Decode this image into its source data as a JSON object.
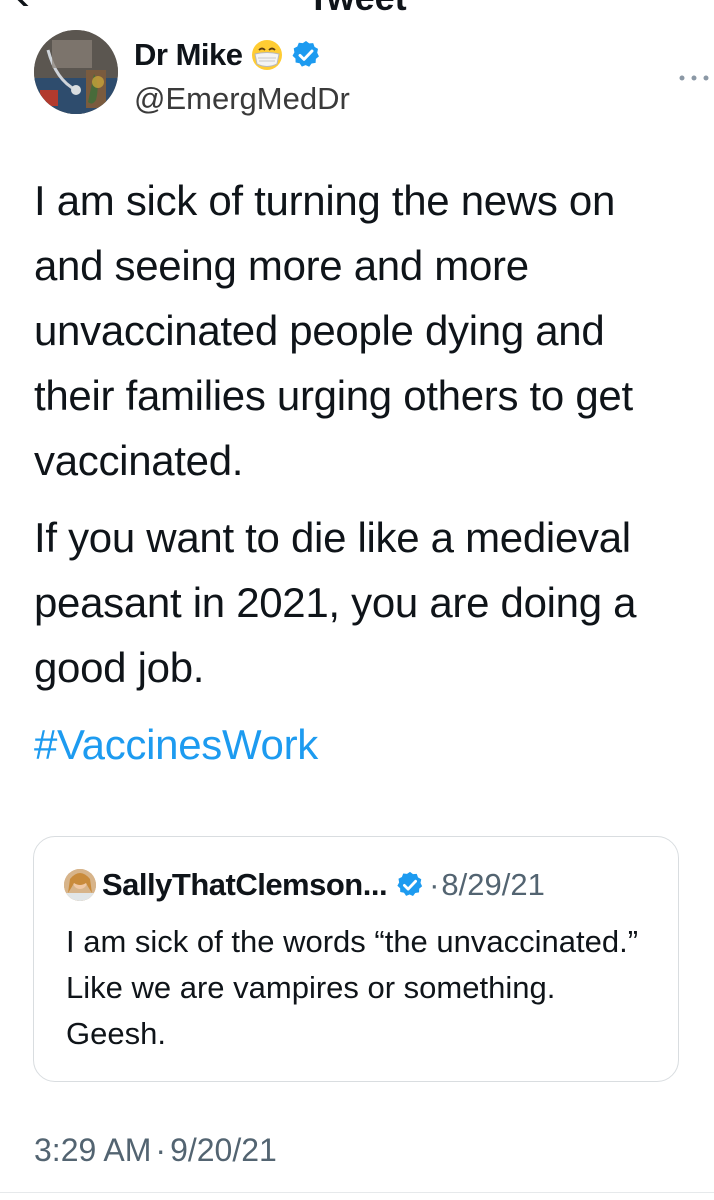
{
  "header": {
    "title": "Tweet"
  },
  "author": {
    "name": "Dr Mike",
    "handle": "@EmergMedDr",
    "name_emoji": "face-with-medical-mask-emoji",
    "verified": true
  },
  "tweet": {
    "paragraph1": "I am sick of turning the news on and seeing more and more unvaccinated people dying and their families urging others to get vaccinated.",
    "paragraph2": "If you want to die like a medieval peasant in 2021, you are doing a good job.",
    "hashtag": "#VaccinesWork"
  },
  "quoted_tweet": {
    "author_name": "SallyThatClemson...",
    "verified": true,
    "separator": "·",
    "date": "8/29/21",
    "text": "I am sick of the words “the unvaccinated.” Like we are vampires or something. Geesh."
  },
  "meta": {
    "time": "3:29 AM",
    "separator": "·",
    "date": "9/20/21"
  },
  "colors": {
    "link": "#1d9bf0",
    "verified": "#1d9bf0",
    "secondary_text": "#536471",
    "border": "#d9dde0"
  },
  "icons": {
    "back": "back-arrow-icon",
    "more": "more-options-icon",
    "verified": "verified-badge-icon"
  }
}
